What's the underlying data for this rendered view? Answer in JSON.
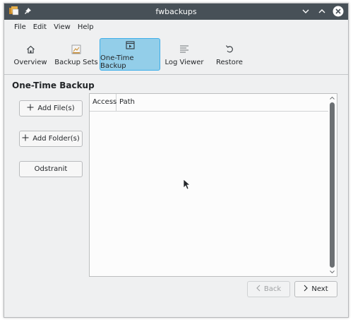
{
  "window": {
    "title": "fwbackups"
  },
  "menubar": {
    "items": [
      "File",
      "Edit",
      "View",
      "Help"
    ]
  },
  "toolbar": {
    "items": [
      {
        "label": "Overview",
        "icon": "home-icon",
        "active": false
      },
      {
        "label": "Backup Sets",
        "icon": "backup-sets-icon",
        "active": false
      },
      {
        "label": "One-Time Backup",
        "icon": "one-time-backup-icon",
        "active": true
      },
      {
        "label": "Log Viewer",
        "icon": "log-viewer-icon",
        "active": false
      },
      {
        "label": "Restore",
        "icon": "restore-icon",
        "active": false
      }
    ]
  },
  "page": {
    "title": "One-Time Backup",
    "add_files": "Add File(s)",
    "add_folder": "Add Folder(s)",
    "remove": "Odstranit",
    "table": {
      "columns": [
        "Access",
        "Path"
      ],
      "rows": []
    },
    "back": "Back",
    "next": "Next"
  },
  "colors": {
    "titlebar": "#475057",
    "active_tool": "#93cee9",
    "accent": "#3daee9"
  }
}
